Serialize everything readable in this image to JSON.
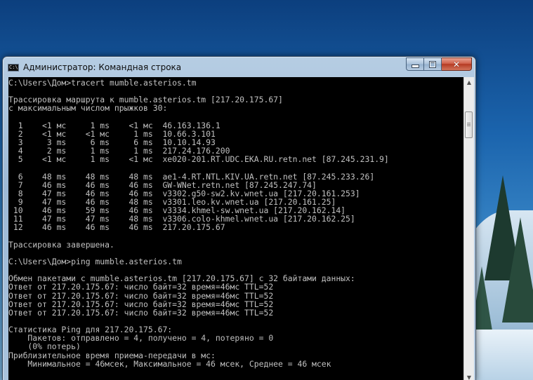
{
  "window": {
    "title": "Администратор: Командная строка",
    "icon_label": "C:\\"
  },
  "console": {
    "lines": [
      "C:\\Users\\Дом>tracert mumble.asterios.tm",
      "",
      "Трассировка маршрута к mumble.asterios.tm [217.20.175.67]",
      "с максимальным числом прыжков 30:",
      "",
      "  1    <1 мс     1 ms    <1 мс  46.163.136.1",
      "  2    <1 мс    <1 мс     1 ms  10.66.3.101",
      "  3     3 ms     6 ms     6 ms  10.10.14.93",
      "  4     2 ms     1 ms     1 ms  217.24.176.200",
      "  5    <1 мс     1 ms    <1 мс  xe020-201.RT.UDC.EKA.RU.retn.net [87.245.231.9]",
      "",
      "  6    48 ms    48 ms    48 ms  ae1-4.RT.NTL.KIV.UA.retn.net [87.245.233.26]",
      "  7    46 ms    46 ms    46 ms  GW-WNet.retn.net [87.245.247.74]",
      "  8    47 ms    46 ms    46 ms  v3302.g50-sw2.kv.wnet.ua [217.20.161.253]",
      "  9    47 ms    46 ms    48 ms  v3301.leo.kv.wnet.ua [217.20.161.25]",
      " 10    46 ms    59 ms    46 ms  v3334.khmel-sw.wnet.ua [217.20.162.14]",
      " 11    47 ms    47 ms    48 ms  v3306.colo-khmel.wnet.ua [217.20.162.25]",
      " 12    46 ms    46 ms    46 ms  217.20.175.67",
      "",
      "Трассировка завершена.",
      "",
      "C:\\Users\\Дом>ping mumble.asterios.tm",
      "",
      "Обмен пакетами с mumble.asterios.tm [217.20.175.67] с 32 байтами данных:",
      "Ответ от 217.20.175.67: число байт=32 время=46мс TTL=52",
      "Ответ от 217.20.175.67: число байт=32 время=46мс TTL=52",
      "Ответ от 217.20.175.67: число байт=32 время=46мс TTL=52",
      "Ответ от 217.20.175.67: число байт=32 время=46мс TTL=52",
      "",
      "Статистика Ping для 217.20.175.67:",
      "    Пакетов: отправлено = 4, получено = 4, потеряно = 0",
      "    (0% потерь)",
      "Приблизительное время приема-передачи в мс:",
      "    Минимальное = 46мсек, Максимальное = 46 мсек, Среднее = 46 мсек"
    ]
  },
  "colors": {
    "console_bg": "#000000",
    "console_fg": "#c0c0c0"
  },
  "icons": {
    "app": "cmd-icon",
    "minimize": "minimize-icon",
    "maximize": "maximize-icon",
    "close": "close-icon",
    "scroll_up": "arrow-up-icon",
    "scroll_down": "arrow-down-icon"
  }
}
